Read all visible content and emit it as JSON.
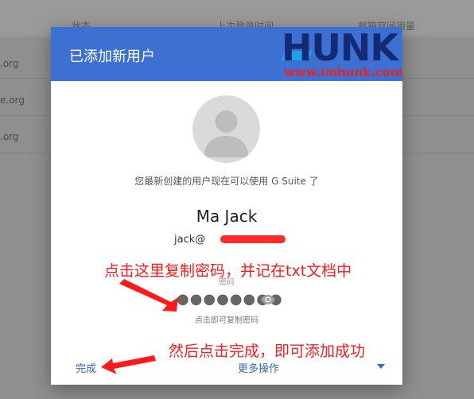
{
  "background": {
    "columns": [
      "状态",
      "上次登录时间",
      "邮箱容间用量"
    ],
    "rows": [
      ".org",
      "e.org",
      ".org"
    ]
  },
  "dialog": {
    "title": "已添加新用户",
    "message": "您最新创建的用户现在可以使用 G Suite 了",
    "user_name": "Ma Jack",
    "email_prefix": "jack@",
    "password_label": "密码",
    "password_mask": "●●●●●●●●",
    "copy_hint": "点击即可复制密码",
    "done_label": "完成",
    "more_label": "更多操作"
  },
  "watermark": {
    "brand": "HUNK",
    "url": "www.imhunk.com"
  },
  "annotations": {
    "copy_note": "点击这里复制密码，并记在txt文档中",
    "done_note": "然后点击完成，即可添加成功"
  },
  "colors": {
    "header_blue": "#3c70d3",
    "link_blue": "#3567c6",
    "annotation_red": "#ff1a1a",
    "logo_navy": "#142a75",
    "logo_cyan": "#1ba1e6"
  }
}
